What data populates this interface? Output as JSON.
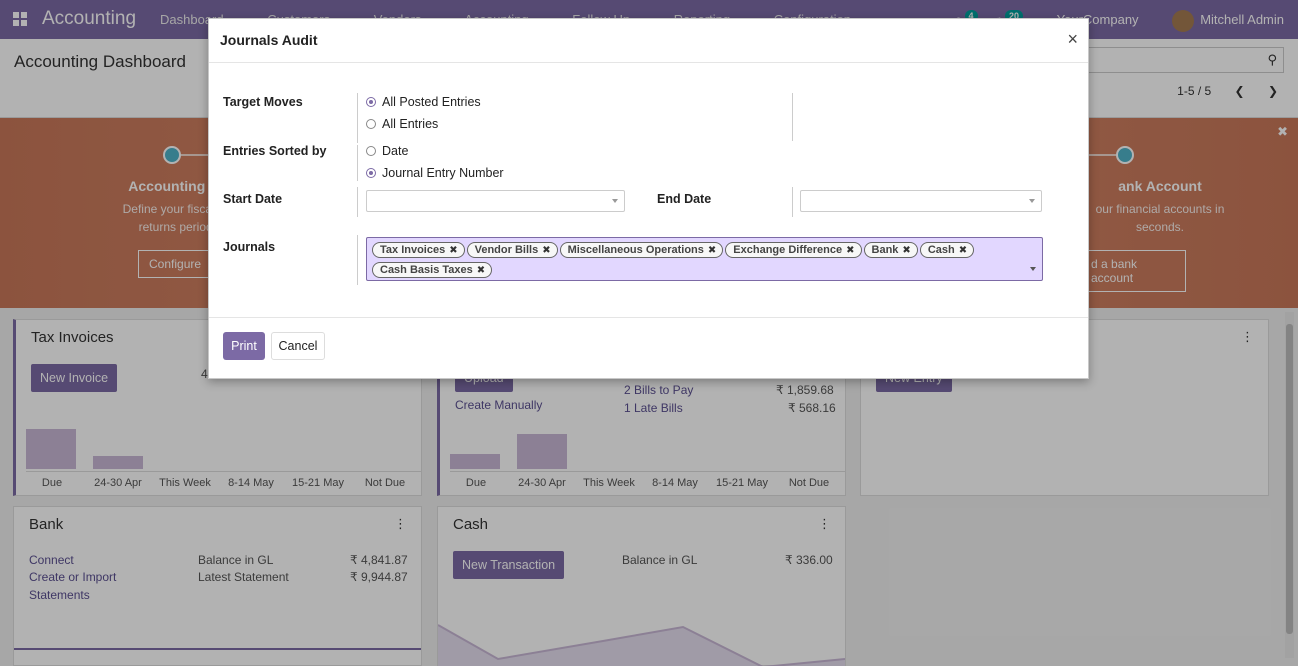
{
  "navbar": {
    "app_name": "Accounting",
    "menu": [
      "Dashboard",
      "Customers",
      "Vendors",
      "Accounting",
      "Follow Up",
      "Reporting",
      "Configuration"
    ],
    "chat_count": "4",
    "activity_count": "20",
    "company": "YourCompany",
    "user": "Mitchell Admin"
  },
  "controlpanel": {
    "breadcrumb": "Accounting Dashboard",
    "pager": "1-5 / 5"
  },
  "banner": {
    "step1_title": "Accounting Per",
    "step1_desc_1": "Define your fiscal yea",
    "step1_desc_2": "returns periodic",
    "step1_button": "Configure",
    "step2_title": "ank Account",
    "step2_desc_1": "our financial accounts in",
    "step2_desc_2": "seconds.",
    "step2_button": "d a bank account"
  },
  "cards": {
    "tax_invoices": {
      "title": "Tax Invoices",
      "button": "New Invoice",
      "count_fragment": "4",
      "bar_labels": [
        "Due",
        "24-30 Apr",
        "This Week",
        "8-14 May",
        "15-21 May",
        "Not Due"
      ]
    },
    "vendor_bills": {
      "button_fragment": "Upload",
      "create_manually": "Create Manually",
      "bills_to_pay": "2 Bills to Pay",
      "bills_to_pay_amount": "₹ 1,859.68",
      "late_bills": "1 Late Bills",
      "late_bills_amount": "₹ 568.16",
      "bar_labels": [
        "Due",
        "24-30 Apr",
        "This Week",
        "8-14 May",
        "15-21 May",
        "Not Due"
      ]
    },
    "misc": {
      "button_fragment": "New Entry"
    },
    "bank": {
      "title": "Bank",
      "connect": "Connect",
      "create_import": "Create or Import",
      "statements": "Statements",
      "balance_gl_label": "Balance in GL",
      "balance_gl_value": "₹ 4,841.87",
      "latest_statement_label": "Latest Statement",
      "latest_statement_value": "₹ 9,944.87"
    },
    "cash": {
      "title": "Cash",
      "button": "New Transaction",
      "balance_gl_label": "Balance in GL",
      "balance_gl_value": "₹ 336.00"
    }
  },
  "modal": {
    "title": "Journals Audit",
    "target_moves_label": "Target Moves",
    "target_moves_options": [
      {
        "label": "All Posted Entries",
        "selected": true
      },
      {
        "label": "All Entries",
        "selected": false
      }
    ],
    "sorted_by_label": "Entries Sorted by",
    "sorted_by_options": [
      {
        "label": "Date",
        "selected": false
      },
      {
        "label": "Journal Entry Number",
        "selected": true
      }
    ],
    "start_date_label": "Start Date",
    "start_date_value": "",
    "end_date_label": "End Date",
    "end_date_value": "",
    "journals_label": "Journals",
    "journals": [
      "Tax Invoices",
      "Vendor Bills",
      "Miscellaneous Operations",
      "Exchange Difference",
      "Bank",
      "Cash",
      "Cash Basis Taxes"
    ],
    "print_button": "Print",
    "cancel_button": "Cancel"
  },
  "colors": {
    "brand": "#7c6aa5",
    "tag_bg": "#e2d7ff",
    "banner": "#d78a6a"
  }
}
